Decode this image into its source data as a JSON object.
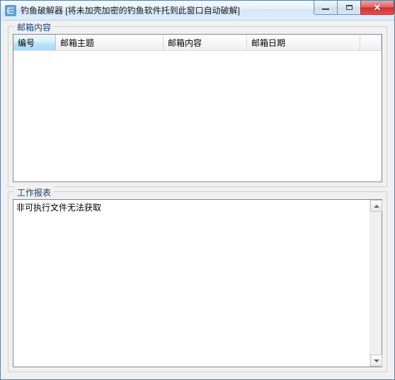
{
  "window": {
    "title": "钓鱼破解器   [将未加壳加密的钓鱼软件托到此窗口自动破解]"
  },
  "groups": {
    "mail_label": "邮箱内容",
    "report_label": "工作报表"
  },
  "listview": {
    "columns": {
      "id": "编号",
      "subject": "邮箱主题",
      "content": "邮箱内容",
      "date": "邮箱日期"
    }
  },
  "report": {
    "text": "非可执行文件无法获取"
  }
}
